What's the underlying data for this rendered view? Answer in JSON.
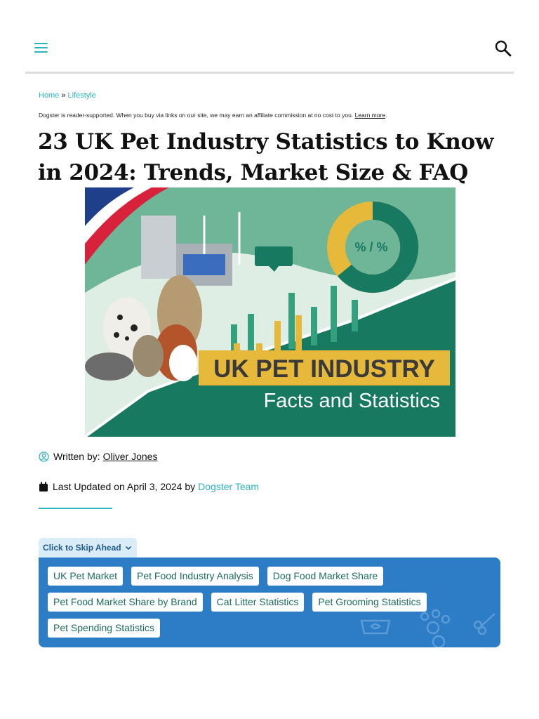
{
  "header": {
    "menu_icon": "hamburger-menu-icon",
    "search_icon": "search-icon",
    "accent_color": "#2cb5c0"
  },
  "breadcrumb": {
    "items": [
      "Home",
      "Lifestyle"
    ],
    "separator": "»"
  },
  "disclaimer": {
    "text": "Dogster is reader-supported. When you buy via links on our site, we may earn an affiliate commission at no cost to you.",
    "link": "Learn more",
    "suffix": "."
  },
  "article": {
    "title": "23 UK Pet Industry Statistics to Know in 2024: Trends, Market Size & FAQ",
    "hero": {
      "donut_label": "% / %",
      "headline": "UK PET INDUSTRY",
      "subheadline": "Facts and Statistics"
    },
    "author_prefix": "Written by:",
    "author": "Oliver Jones",
    "updated_prefix": "Last Updated on April 3, 2024 by",
    "updated_by": "Dogster Team"
  },
  "toc": {
    "toggle_label": "Click to Skip Ahead",
    "links": [
      "UK Pet Market",
      "Pet Food Industry Analysis",
      "Dog Food Market Share",
      "Pet Food Market Share by Brand",
      "Cat Litter Statistics",
      "Pet Grooming Statistics",
      "Pet Spending Statistics"
    ],
    "colors": {
      "box": "#2d7dc6",
      "tab": "#d9ecf7",
      "chip_text": "#1c6e5b"
    }
  }
}
